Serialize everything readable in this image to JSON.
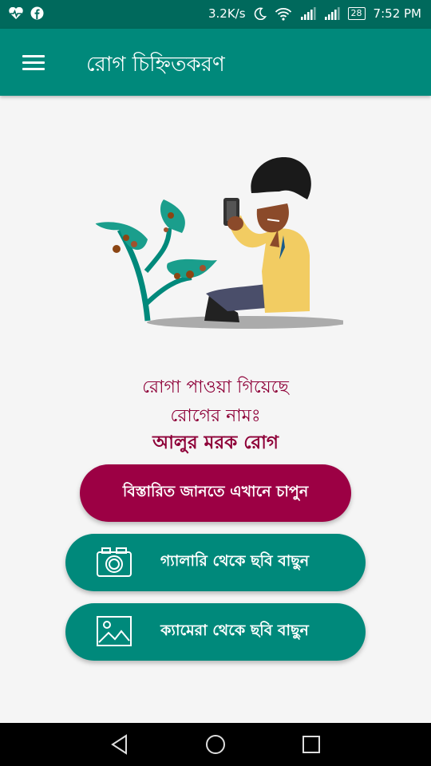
{
  "status_bar": {
    "network_speed": "3.2K/s",
    "battery": "28",
    "time": "7:52 PM",
    "icons": [
      "heart-monitor-icon",
      "facebook-icon",
      "moon-icon",
      "wifi-icon",
      "signal-icon",
      "signal-icon",
      "battery-icon"
    ]
  },
  "app_bar": {
    "title": "রোগ চিহ্নিতকরণ",
    "menu_icon": "hamburger-menu-icon"
  },
  "result": {
    "line1": "রোগা পাওয়া গিয়েছে",
    "line2": "রোগের নামঃ",
    "disease_name": "আলুর মরক রোগ"
  },
  "buttons": {
    "details": "বিস্তারিত জানতে এখানে চাপুন",
    "gallery": "গ্যালারি থেকে ছবি বাছুন",
    "camera": "ক্যামেরা থেকে ছবি বাছুন"
  },
  "colors": {
    "primary": "#00897b",
    "primary_dark": "#00695c",
    "accent": "#9c0044",
    "text_accent": "#8e0038"
  }
}
